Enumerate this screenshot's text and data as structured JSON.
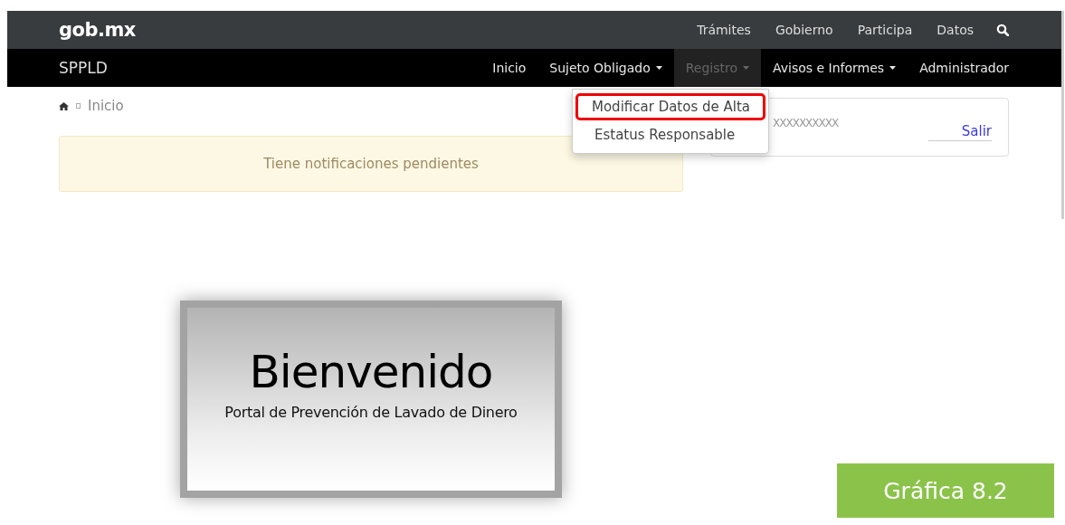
{
  "top_bar": {
    "logo": "gob.mx",
    "links": [
      "Trámites",
      "Gobierno",
      "Participa",
      "Datos"
    ]
  },
  "nav_bar": {
    "brand": "SPPLD",
    "items": [
      {
        "label": "Inicio",
        "dropdown": false,
        "selected": false
      },
      {
        "label": "Sujeto Obligado",
        "dropdown": true,
        "selected": false
      },
      {
        "label": "Registro",
        "dropdown": true,
        "selected": true
      },
      {
        "label": "Avisos e Informes",
        "dropdown": true,
        "selected": false
      },
      {
        "label": "Administrador",
        "dropdown": false,
        "selected": false
      }
    ]
  },
  "dropdown_menu": {
    "items": [
      {
        "label": "Modificar Datos de Alta",
        "highlighted": true
      },
      {
        "label": "Estatus Responsable",
        "highlighted": false
      }
    ]
  },
  "breadcrumb": {
    "current": "Inicio"
  },
  "alert": "Tiene notificaciones pendientes",
  "user_panel": {
    "user": "XXXXXXXXXX",
    "logout": "Salir"
  },
  "banner": {
    "title": "Bienvenido",
    "subtitle": "Portal de Prevención de Lavado de Dinero"
  },
  "figure_label": "Gráfica 8.2"
}
